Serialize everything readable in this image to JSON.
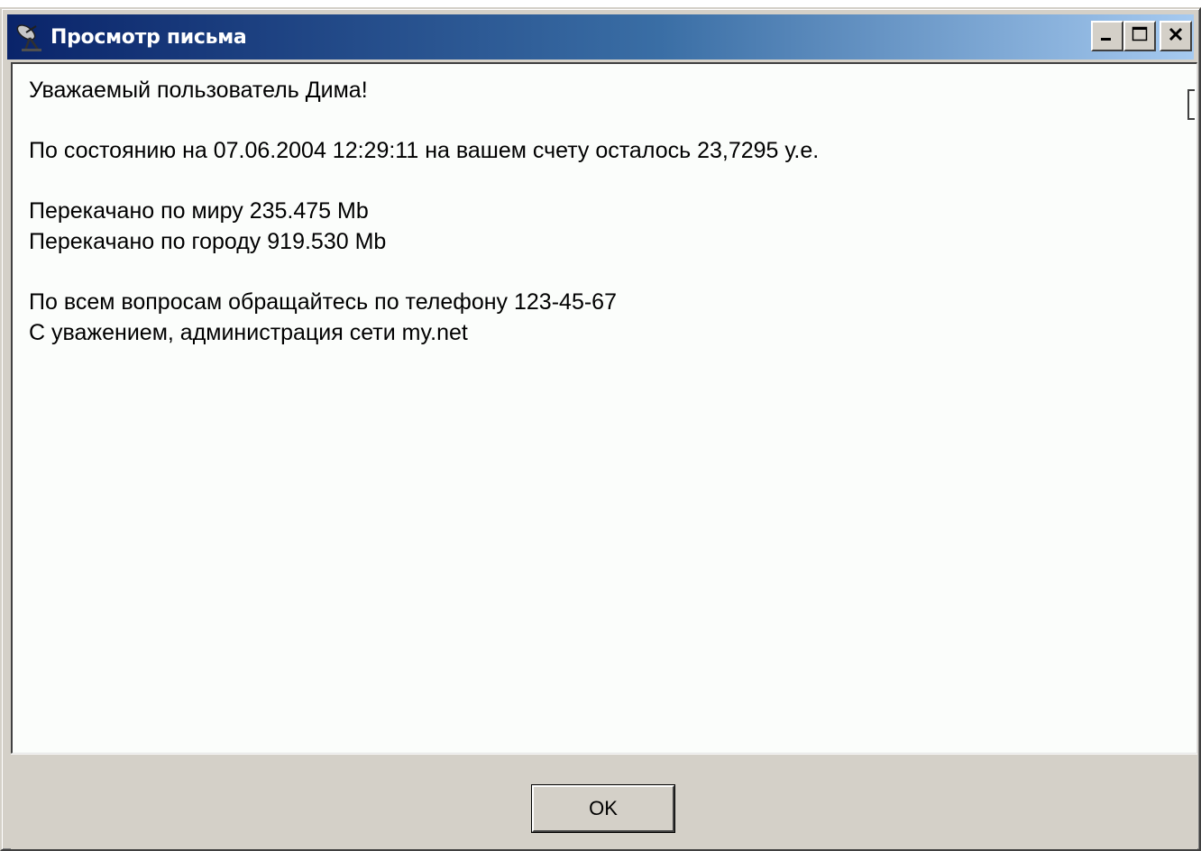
{
  "window": {
    "title": "Просмотр письма",
    "title_icon": "satellite-dish-icon",
    "controls": {
      "minimize": "minimize-icon",
      "maximize": "maximize-icon",
      "close": "close-icon"
    }
  },
  "message": {
    "greeting": "Уважаемый пользователь Дима!",
    "balance": "По состоянию на 07.06.2004 12:29:11 на вашем счету осталось 23,7295 у.е.",
    "traffic_world": "Перекачано по миру 235.475 Mb",
    "traffic_city": "Перекачано по городу 919.530 Mb",
    "contact": "По всем вопросам обращайтесь по телефону 123-45-67",
    "signature": "С уважением, администрация сети my.net"
  },
  "footer": {
    "ok_label": "OK"
  },
  "colors": {
    "title_gradient_start": "#0a246a",
    "title_gradient_end": "#a6caf0",
    "face": "#d4d0c8",
    "content_bg": "#fbfdfb"
  }
}
